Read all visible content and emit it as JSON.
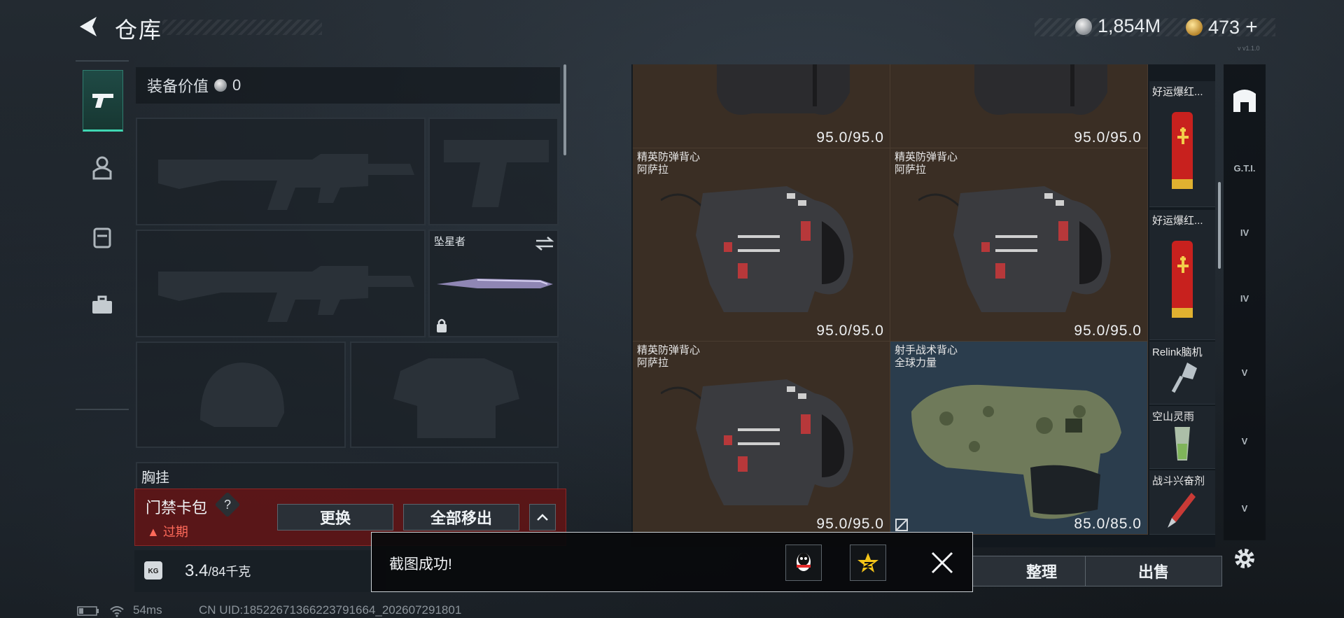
{
  "header": {
    "title": "仓库",
    "currency_silver": "1,854M",
    "currency_gold": "473",
    "add_label": "+",
    "tiny_text": "v v1.1.0"
  },
  "tabs": [
    {
      "name": "weapon-tab-icon",
      "active": true
    },
    {
      "name": "character-tab-icon",
      "active": false
    },
    {
      "name": "backpack-tab-icon",
      "active": false
    },
    {
      "name": "toolbox-tab-icon",
      "active": false
    }
  ],
  "equipment": {
    "value_label": "装备价值",
    "value_amount": "0",
    "melee_label": "坠星者",
    "chest_label": "胸挂"
  },
  "keycard": {
    "title": "门禁卡包",
    "help": "?",
    "status": "过期",
    "replace_label": "更换",
    "remove_all_label": "全部移出",
    "collapse_label": "^"
  },
  "weight": {
    "icon_text": "KG",
    "current": "3.4",
    "max": "/84千克"
  },
  "grid": {
    "items": [
      {
        "name": "",
        "durability": "95.0/95.0",
        "color": "brown"
      },
      {
        "name": "",
        "durability": "95.0/95.0",
        "color": "brown"
      },
      {
        "name": "精英防弹背心\n阿萨拉",
        "durability": "95.0/95.0",
        "color": "brown"
      },
      {
        "name": "精英防弹背心\n阿萨拉",
        "durability": "95.0/95.0",
        "color": "brown"
      },
      {
        "name": "精英防弹背心\n阿萨拉",
        "durability": "95.0/95.0",
        "color": "brown"
      },
      {
        "name": "射手战术背心\n全球力量",
        "durability": "85.0/85.0",
        "color": "blue"
      }
    ],
    "small_items": [
      {
        "name": "好运爆红..."
      },
      {
        "name": "好运爆红..."
      },
      {
        "name": "Relink脑机"
      },
      {
        "name": "空山灵雨"
      },
      {
        "name": "战斗兴奋剂"
      }
    ]
  },
  "right_icons": [
    "home-icon",
    "gti-card-icon",
    "iv-card-icon",
    "iv-card-icon-2",
    "v-card-icon",
    "v-card-icon-2",
    "v-card-icon-3",
    "settings-icon"
  ],
  "right_icon_labels": [
    "",
    "G.T.I.",
    "IV",
    "IV",
    "V",
    "V",
    "V",
    ""
  ],
  "actions": {
    "sort_label": "整理",
    "sell_label": "出售"
  },
  "toast": {
    "message": "截图成功!"
  },
  "status": {
    "ping": "54ms",
    "uid": "CN UID:18522671366223791664_202607291801"
  }
}
